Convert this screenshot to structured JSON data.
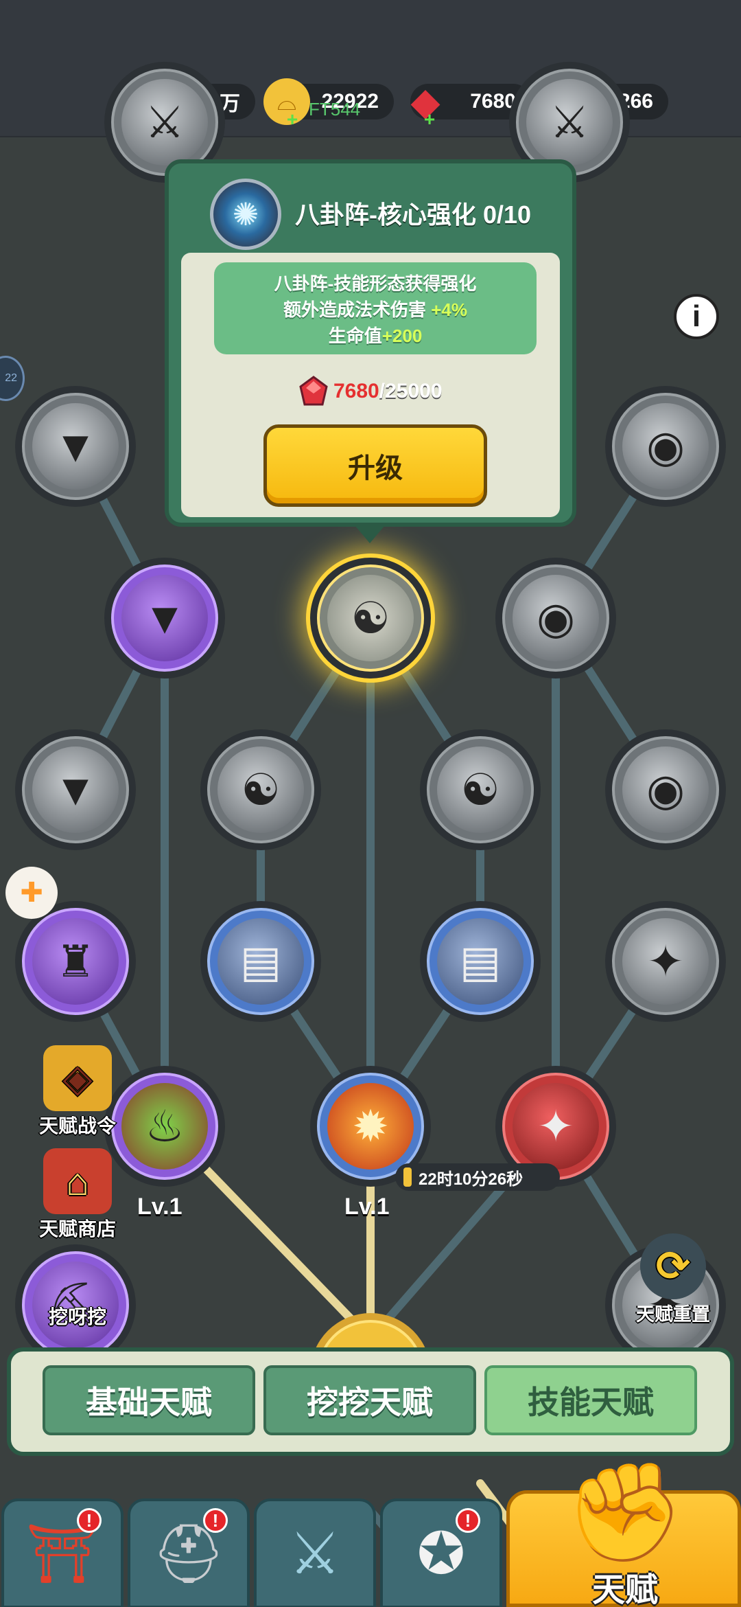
{
  "resources": [
    {
      "name": "silver-coin",
      "icon": "coin-icon",
      "value": "284.7万",
      "color": "#c9d2de"
    },
    {
      "name": "gold-ingot",
      "icon": "ingot-icon",
      "value": "22922",
      "color": "#f2c23a"
    },
    {
      "name": "red-gem",
      "icon": "red-gem-icon",
      "value": "7680",
      "color": "#e0333d"
    },
    {
      "name": "purple-crystal",
      "icon": "purple-crystal-icon",
      "value": "7266",
      "color": "#b46cf2"
    }
  ],
  "overlay_code": "FT544",
  "left_badge": "22",
  "popup": {
    "title": "八卦阵-核心强化 0/10",
    "desc_line1": "八卦阵-技能形态获得强化",
    "desc_line2_prefix": "额外造成法术伤害 ",
    "desc_line2_value": "+4%",
    "desc_line3_prefix": "生命值",
    "desc_line3_value": "+200",
    "cost_have": "7680",
    "cost_need": "/25000",
    "upgrade_label": "升级"
  },
  "nodes": {
    "lv_left": "Lv.1",
    "lv_center": "Lv.1"
  },
  "timer": "22时10分26秒",
  "side_menu": {
    "talent_pass": "天赋战令",
    "talent_shop": "天赋商店",
    "dig": "挖呀挖",
    "reset": "天赋重置"
  },
  "tabs": [
    "基础天赋",
    "挖挖天赋",
    "技能天赋"
  ],
  "active_tab": 2,
  "bottom_nav": {
    "main_label": "天赋",
    "badges": [
      "!",
      "!",
      "!"
    ]
  }
}
